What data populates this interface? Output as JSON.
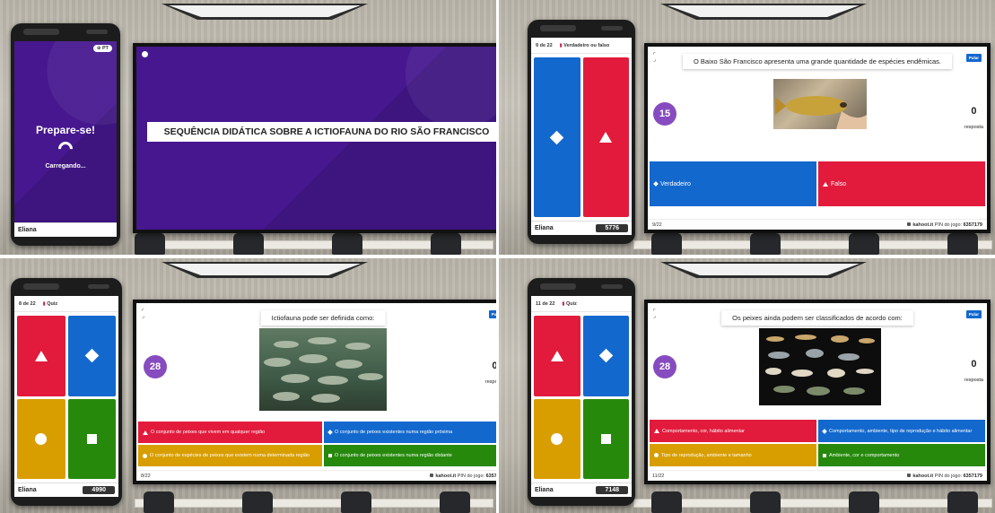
{
  "colors": {
    "red": "#e21b3c",
    "blue": "#1368ce",
    "yellow": "#d89e00",
    "green": "#26890c",
    "purple": "#46178f",
    "timer": "#864cbf"
  },
  "panel1": {
    "phone": {
      "lang": "⊕ PT",
      "heading": "Prepare-se!",
      "status": "Carregando...",
      "player": "Eliana"
    },
    "screen": {
      "title": "SEQUÊNCIA DIDÁTICA SOBRE A ICTIOFAUNA DO RIO SÃO FRANCISCO"
    }
  },
  "panel2": {
    "phone": {
      "progress": "9 de 22",
      "type": "Verdadeiro ou falso",
      "player": "Eliana",
      "score": "5776"
    },
    "screen": {
      "question": "O Baixo São Francisco apresenta uma grande quantidade de espécies endêmicas.",
      "skip": "Pular",
      "timer": "15",
      "answers_count": "0",
      "answers_label": "resposta",
      "options": [
        "Verdadeiro",
        "Falso"
      ],
      "counter": "9/22",
      "brand": "kahoot.it",
      "pin_label": "PIN do jogo:",
      "pin": "6357179"
    }
  },
  "panel3": {
    "phone": {
      "progress": "8 de 22",
      "type": "Quiz",
      "player": "Eliana",
      "score": "4990"
    },
    "screen": {
      "question": "Ictiofauna pode ser definida como:",
      "skip": "Pular",
      "timer": "28",
      "answers_count": "0",
      "answers_label": "resposta",
      "options": [
        "O conjunto de peixes que vivem em qualquer região",
        "O conjunto de peixes existentes numa região próxima",
        "O conjunto de espécies de peixes que existem numa determinada região",
        "O conjunto de peixes existentes numa região distante"
      ],
      "counter": "8/22",
      "brand": "kahoot.it",
      "pin_label": "PIN do jogo:",
      "pin": "6357179"
    }
  },
  "panel4": {
    "phone": {
      "progress": "11 de 22",
      "type": "Quiz",
      "player": "Eliana",
      "score": "7148"
    },
    "screen": {
      "question": "Os peixes ainda podem ser classificados de acordo com:",
      "skip": "Pular",
      "timer": "28",
      "answers_count": "0",
      "answers_label": "resposta",
      "options": [
        "Comportamento, cor, hábito alimentar",
        "Comportamento, ambiente, tipo de reprodução e hábito alimentar",
        "Tipo de reprodução, ambiente e tamanho",
        "Ambiente, cor e comportamento"
      ],
      "counter": "11/22",
      "brand": "kahoot.it",
      "pin_label": "PIN do jogo:",
      "pin": "6357179"
    }
  }
}
